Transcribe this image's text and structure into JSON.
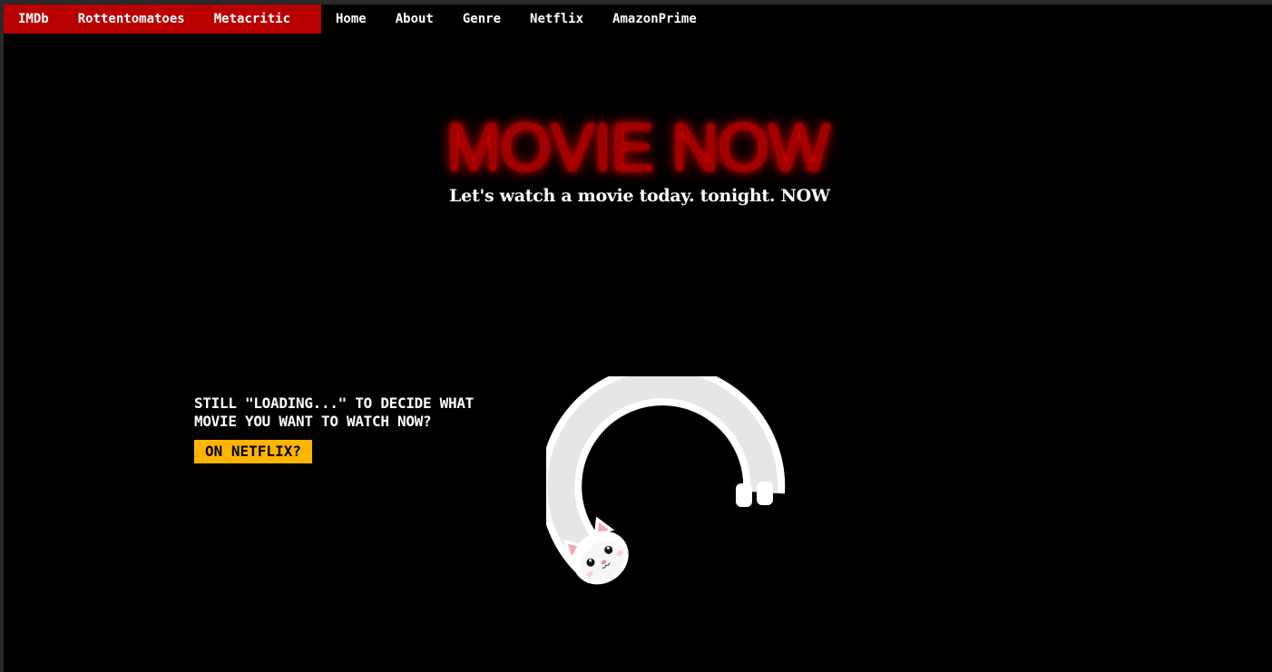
{
  "nav": {
    "primary": [
      {
        "label": "IMDb"
      },
      {
        "label": "Rottentomatoes"
      },
      {
        "label": "Metacritic"
      }
    ],
    "secondary": [
      {
        "label": "Home"
      },
      {
        "label": "About"
      },
      {
        "label": "Genre"
      },
      {
        "label": "Netflix"
      },
      {
        "label": "AmazonPrime"
      }
    ]
  },
  "hero": {
    "title": "MOVIE NOW",
    "tagline": "Let's watch a movie today. tonight. NOW"
  },
  "promo": {
    "question": "STILL \"LOADING...\" TO DECIDE WHAT MOVIE YOU WANT TO WATCH NOW?",
    "button_label": "ON NETFLIX?"
  },
  "colors": {
    "nav_red": "#b90000",
    "title_red": "#a00000",
    "button_yellow": "#ffb400",
    "background": "#000000"
  },
  "icons": {
    "loader": "cat-loader-icon"
  }
}
